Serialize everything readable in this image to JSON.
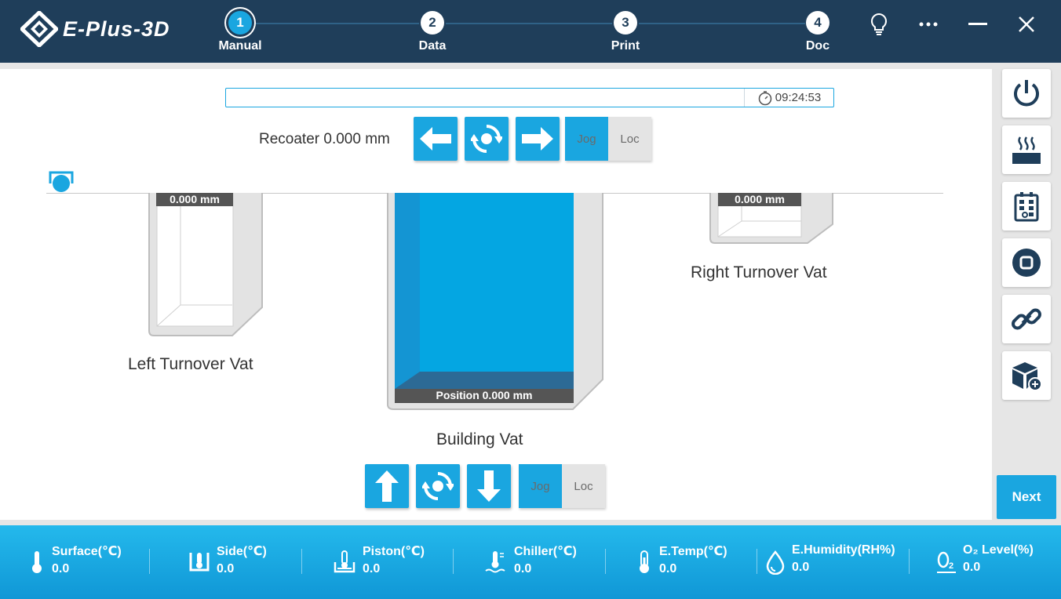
{
  "app": {
    "logo_text": "E-Plus-3D"
  },
  "steps": [
    {
      "num": "1",
      "label": "Manual",
      "active": true
    },
    {
      "num": "2",
      "label": "Data",
      "active": false
    },
    {
      "num": "3",
      "label": "Print",
      "active": false
    },
    {
      "num": "4",
      "label": "Doc",
      "active": false
    }
  ],
  "window": {
    "icons": [
      "lightbulb-icon",
      "more-icon",
      "minimize-icon",
      "close-icon"
    ]
  },
  "progress": {
    "value": 0,
    "time": "09:24:53"
  },
  "recoater": {
    "label": "Recoater 0.000 mm",
    "mode_jog": "Jog",
    "mode_loc": "Loc",
    "active_mode": "Jog"
  },
  "vats": {
    "left": {
      "label": "Left Turnover Vat",
      "value": "0.000 mm"
    },
    "building": {
      "label": "Building Vat",
      "position": "Position 0.000 mm"
    },
    "right": {
      "label": "Right Turnover Vat",
      "value": "0.000 mm"
    }
  },
  "building_controls": {
    "mode_jog": "Jog",
    "mode_loc": "Loc",
    "active_mode": "Jog"
  },
  "sidebar": {
    "icons": [
      "power-icon",
      "heater-icon",
      "control-panel-icon",
      "stop-icon",
      "link-icon",
      "box-add-icon"
    ]
  },
  "next_label": "Next",
  "status": [
    {
      "name": "Surface(℃)",
      "value": "0.0",
      "icon": "thermometer-icon"
    },
    {
      "name": "Side(℃)",
      "value": "0.0",
      "icon": "side-temp-icon"
    },
    {
      "name": "Piston(℃)",
      "value": "0.0",
      "icon": "piston-temp-icon"
    },
    {
      "name": "Chiller(℃)",
      "value": "0.0",
      "icon": "chiller-icon"
    },
    {
      "name": "E.Temp(℃)",
      "value": "0.0",
      "icon": "env-temp-icon"
    },
    {
      "name": "E.Humidity(RH%)",
      "value": "0.0",
      "icon": "humidity-icon"
    },
    {
      "name": "O₂ Level(%)",
      "value": "0.0",
      "icon": "oxygen-icon"
    }
  ],
  "colors": {
    "accent": "#1aa6e0",
    "header": "#1f3e5a",
    "vat_blue": "#04a6e2"
  }
}
